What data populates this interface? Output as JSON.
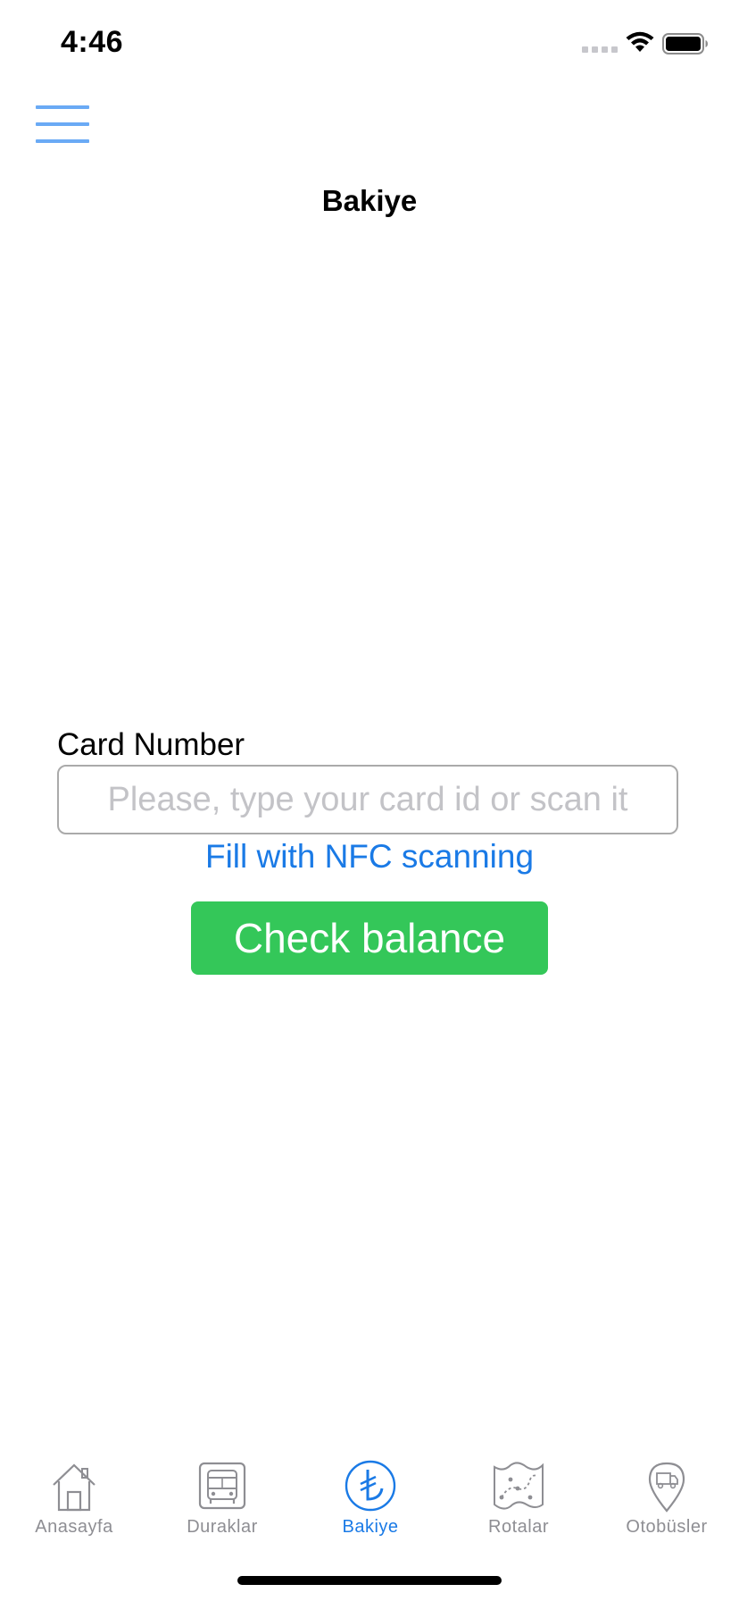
{
  "status_bar": {
    "time": "4:46",
    "icons": [
      "signal-icon",
      "wifi-icon",
      "battery-icon"
    ]
  },
  "header": {
    "menu_icon": "hamburger-menu-icon",
    "title": "Bakiye"
  },
  "form": {
    "card_label": "Card Number",
    "card_input_placeholder": "Please, type your card id or scan it",
    "card_input_value": "",
    "nfc_link": "Fill with NFC scanning",
    "check_button": "Check balance"
  },
  "tab_bar": {
    "active_index": 2,
    "items": [
      {
        "label": "Anasayfa",
        "icon": "home-icon"
      },
      {
        "label": "Duraklar",
        "icon": "bus-stop-icon"
      },
      {
        "label": "Bakiye",
        "icon": "lira-icon"
      },
      {
        "label": "Rotalar",
        "icon": "route-map-icon"
      },
      {
        "label": "Otobüsler",
        "icon": "bus-location-icon"
      }
    ]
  },
  "colors": {
    "accent": "#1a7ae6",
    "menu": "#6aaaf5",
    "check_button": "#34c759",
    "tab_inactive": "#8e8e93"
  }
}
